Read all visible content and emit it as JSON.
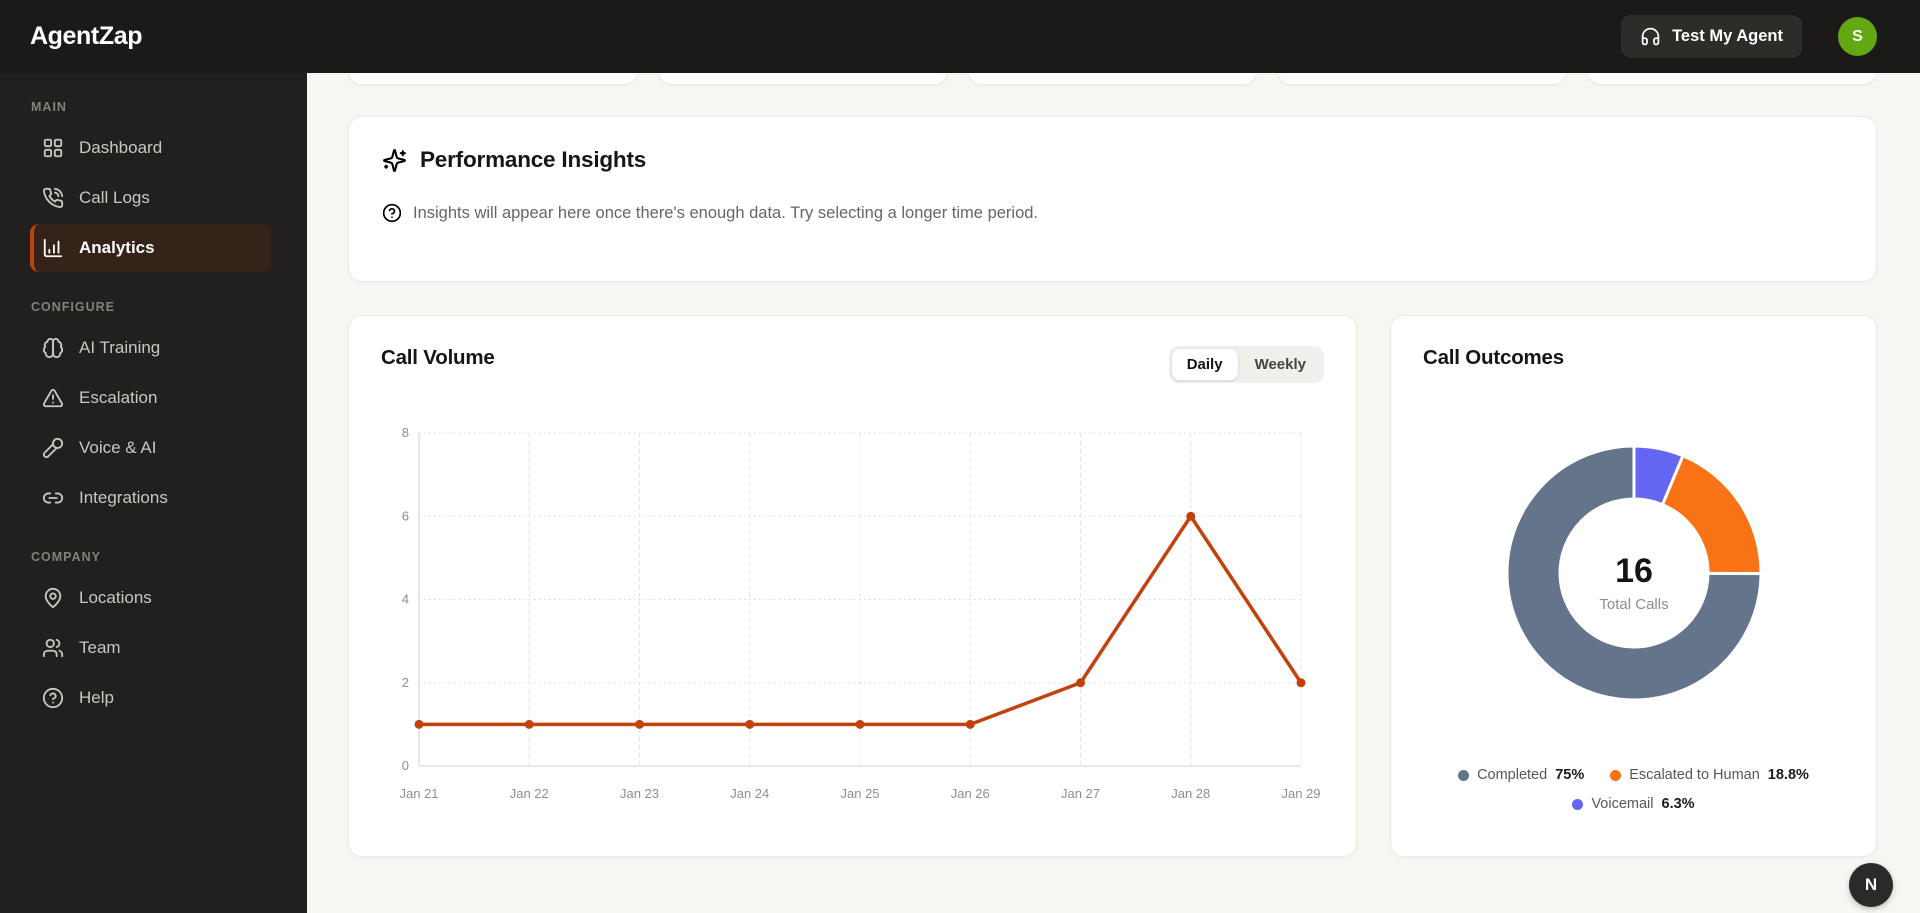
{
  "app": {
    "logo": "AgentZap"
  },
  "topbar": {
    "test_agent_label": "Test My Agent",
    "avatar_initial": "S"
  },
  "sidebar": {
    "sections": [
      {
        "label": "MAIN",
        "items": [
          {
            "label": "Dashboard",
            "icon": "dashboard-icon",
            "active": false
          },
          {
            "label": "Call Logs",
            "icon": "phone-icon",
            "active": false
          },
          {
            "label": "Analytics",
            "icon": "bar-chart-icon",
            "active": true
          }
        ]
      },
      {
        "label": "CONFIGURE",
        "items": [
          {
            "label": "AI Training",
            "icon": "brain-icon",
            "active": false
          },
          {
            "label": "Escalation",
            "icon": "alert-triangle-icon",
            "active": false
          },
          {
            "label": "Voice & AI",
            "icon": "microphone-icon",
            "active": false
          },
          {
            "label": "Integrations",
            "icon": "link-icon",
            "active": false
          }
        ]
      },
      {
        "label": "COMPANY",
        "items": [
          {
            "label": "Locations",
            "icon": "map-pin-icon",
            "active": false
          },
          {
            "label": "Team",
            "icon": "users-icon",
            "active": false
          },
          {
            "label": "Help",
            "icon": "help-circle-icon",
            "active": false
          }
        ]
      }
    ]
  },
  "insights": {
    "title": "Performance Insights",
    "message": "Insights will appear here once there's enough data. Try selecting a longer time period."
  },
  "call_volume": {
    "title": "Call Volume",
    "toggle": {
      "options": [
        "Daily",
        "Weekly"
      ],
      "selected": "Daily"
    }
  },
  "call_outcomes": {
    "title": "Call Outcomes"
  },
  "floating_button": {
    "label": "N"
  },
  "colors": {
    "accent_orange": "#c2410c",
    "donut_slate": "#64748b",
    "donut_orange": "#f97316",
    "donut_indigo": "#6366f1",
    "avatar_green": "#63a712"
  },
  "chart_data": [
    {
      "type": "line",
      "title": "Call Volume",
      "x": [
        "Jan 21",
        "Jan 22",
        "Jan 23",
        "Jan 24",
        "Jan 25",
        "Jan 26",
        "Jan 27",
        "Jan 28",
        "Jan 29"
      ],
      "values": [
        1,
        1,
        1,
        1,
        1,
        1,
        2,
        6,
        2
      ],
      "ylim": [
        0,
        8
      ],
      "yticks": [
        0,
        2,
        4,
        6,
        8
      ],
      "line_color": "#c2410c",
      "grid": "dotted",
      "legend_position": "none"
    },
    {
      "type": "donut",
      "title": "Call Outcomes",
      "center_value": "16",
      "center_label": "Total Calls",
      "segments": [
        {
          "label": "Completed",
          "pct": 75,
          "pct_label": "75%",
          "color": "#64748b"
        },
        {
          "label": "Escalated to Human",
          "pct": 18.8,
          "pct_label": "18.8%",
          "color": "#f97316"
        },
        {
          "label": "Voicemail",
          "pct": 6.3,
          "pct_label": "6.3%",
          "color": "#6366f1"
        }
      ],
      "legend_position": "bottom"
    }
  ]
}
